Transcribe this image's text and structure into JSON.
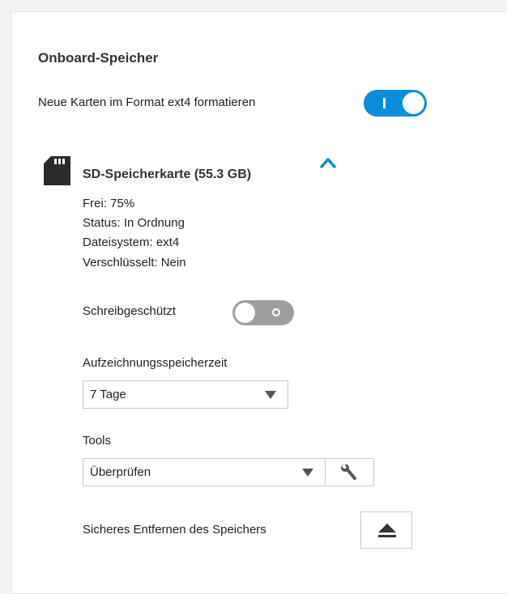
{
  "section": {
    "title": "Onboard-Speicher",
    "format_label": "Neue Karten im Format ext4 formatieren",
    "format_toggle_on": true,
    "accent_color": "#0a8ed9"
  },
  "card": {
    "icon": "sd-card-icon",
    "title": "SD-Speicherkarte (55.3 GB)",
    "expanded": true,
    "free": "Frei: 75%",
    "status": "Status: In Ordnung",
    "filesystem": "Dateisystem: ext4",
    "encrypted": "Verschlüsselt: Nein",
    "write_protect_label": "Schreibgeschützt",
    "write_protect_on": false,
    "retention_label": "Aufzeichnungsspeicherzeit",
    "retention_value": "7 Tage",
    "tools_label": "Tools",
    "tools_value": "Überprüfen",
    "tools_run_icon": "wrench-icon",
    "remove_label": "Sicheres Entfernen des Speichers",
    "eject_icon": "eject-icon"
  }
}
